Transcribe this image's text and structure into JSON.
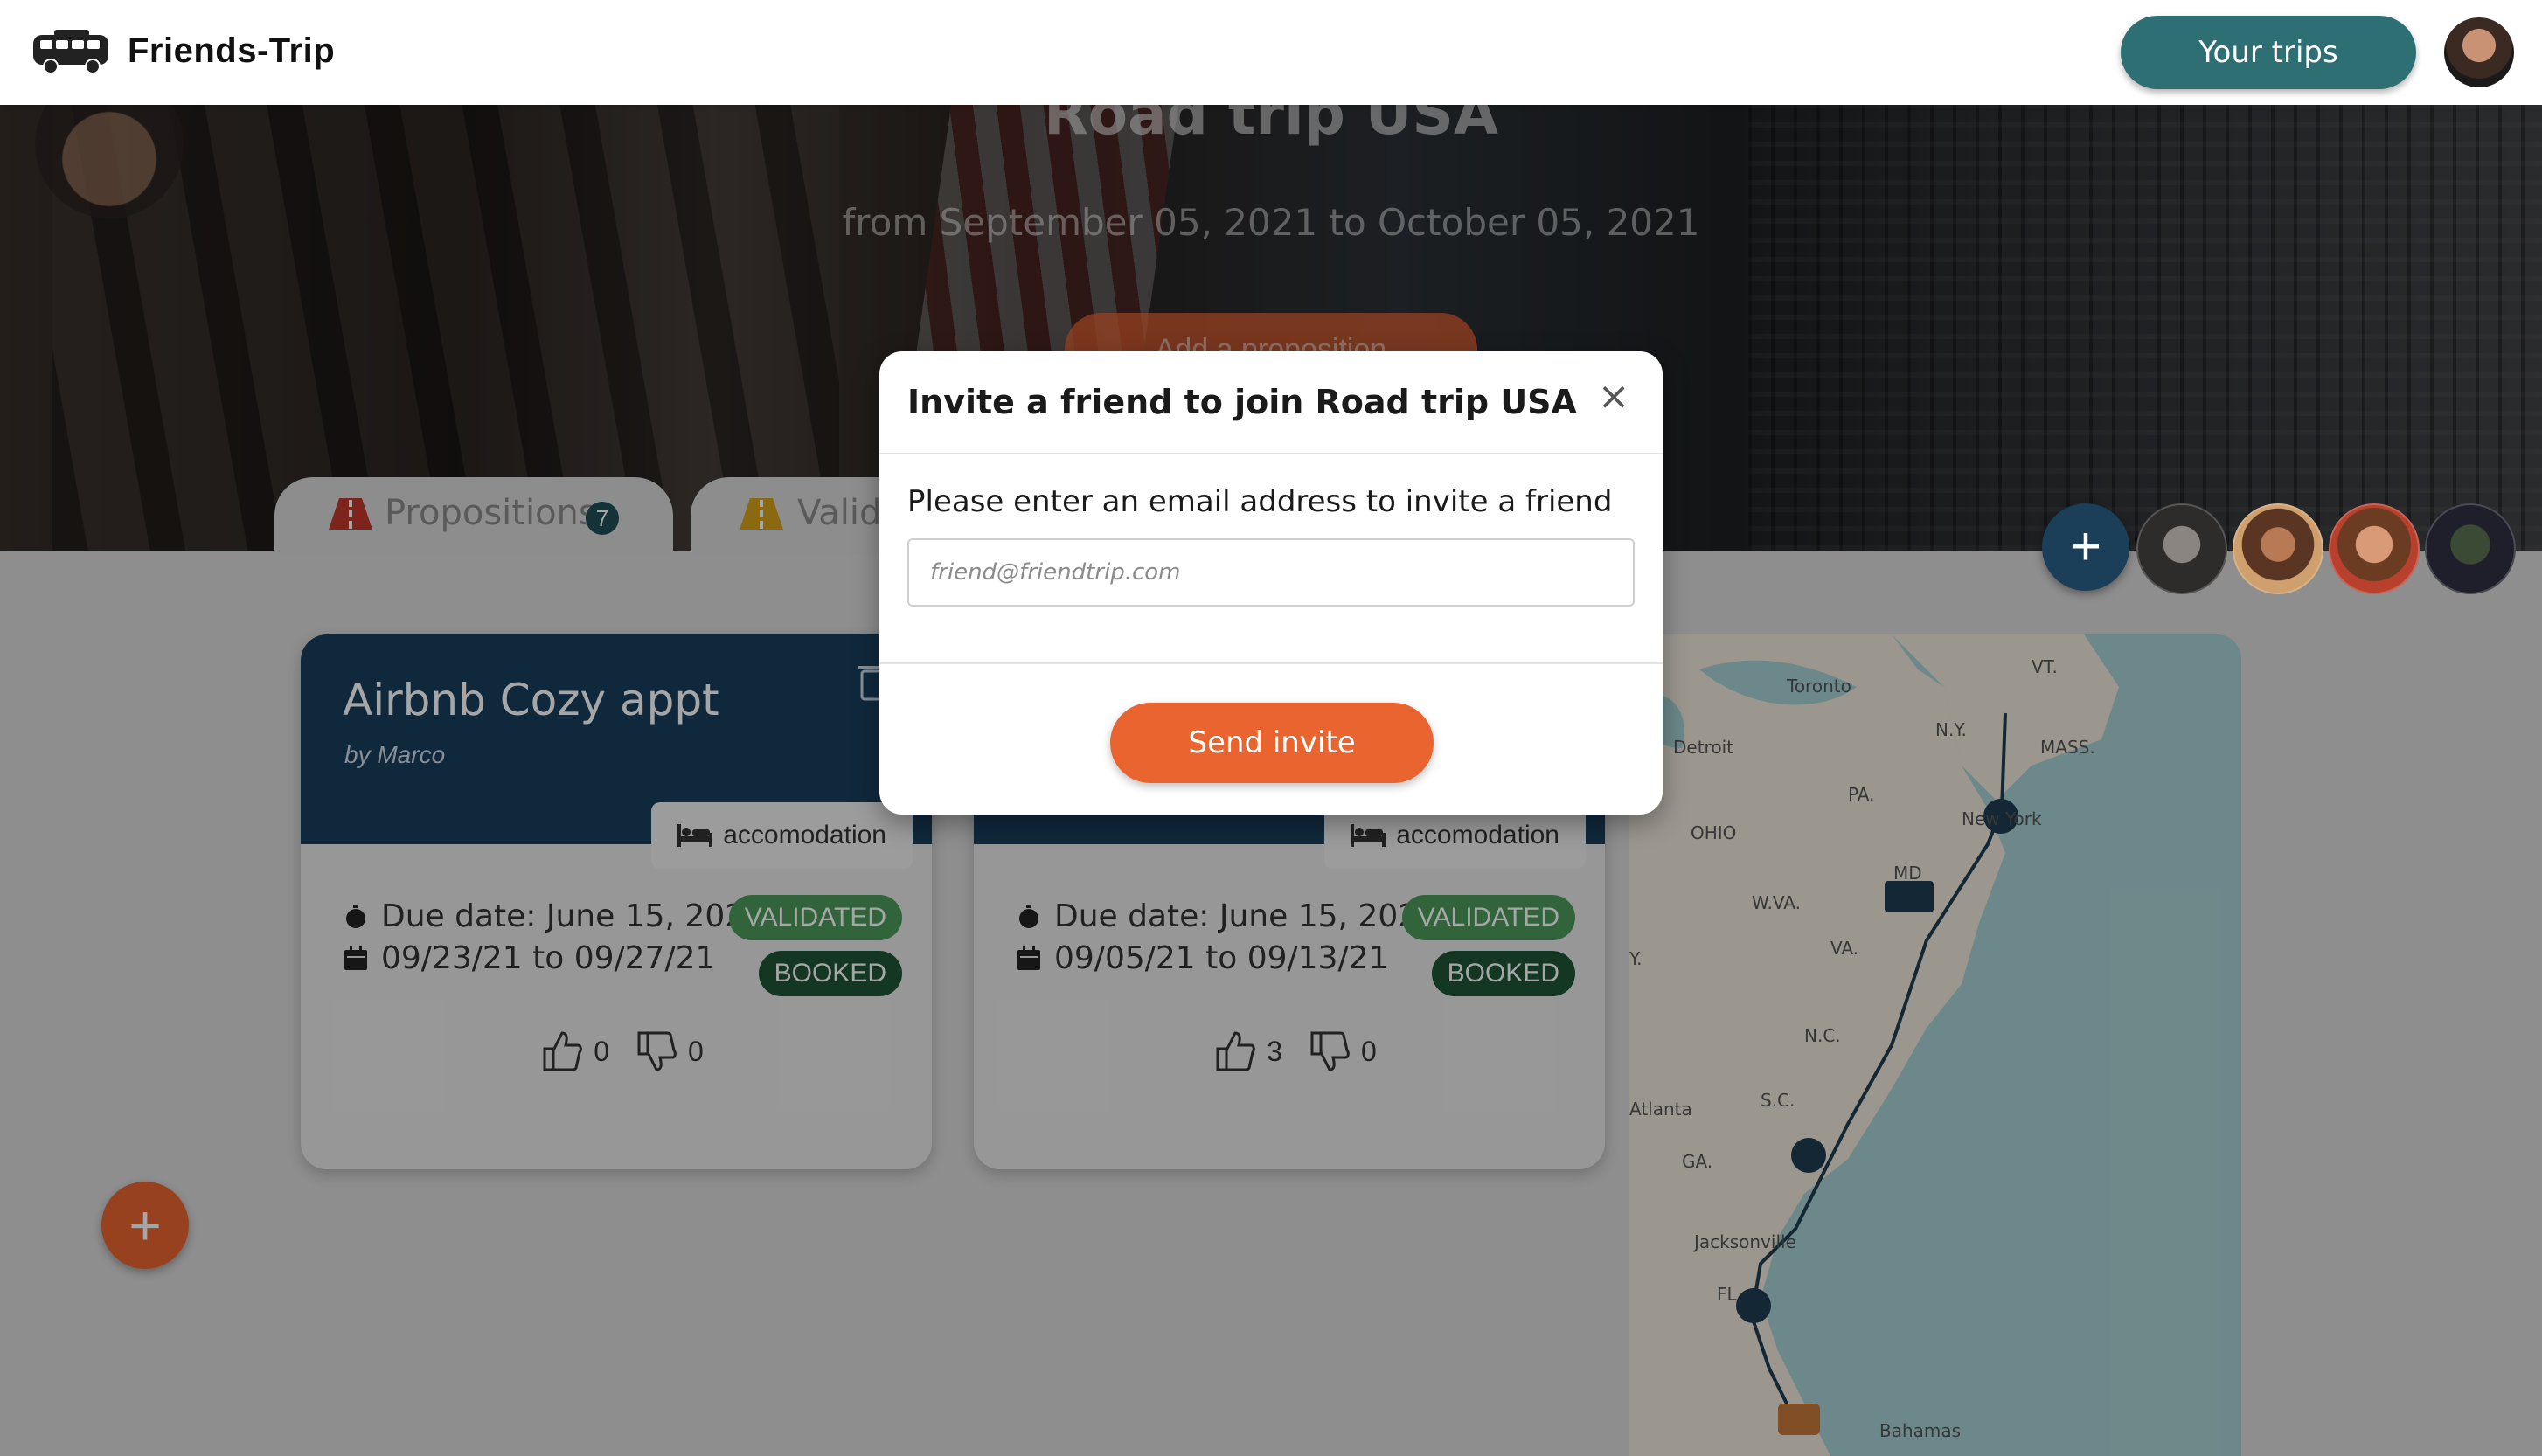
{
  "navbar": {
    "brand": "Friends-Trip",
    "your_trips": "Your trips"
  },
  "trip": {
    "title": "Road trip USA",
    "dates": "from September 05, 2021 to October 05, 2021",
    "add_proposition": "Add a proposition"
  },
  "tabs": [
    {
      "label": "Propositions",
      "count": "7"
    },
    {
      "label": "Valid"
    }
  ],
  "cards": [
    {
      "title": "Airbnb Cozy appt",
      "author": "by Marco",
      "category": "accomodation",
      "due": "Due date: June 15, 2021",
      "range": "09/23/21 to 09/27/21",
      "status_validated": "VALIDATED",
      "status_booked": "BOOKED",
      "likes": "0",
      "dislikes": "0"
    },
    {
      "title": "",
      "author": "",
      "category": "accomodation",
      "due": "Due date: June 15, 2021",
      "range": "09/05/21 to 09/13/21",
      "status_validated": "VALIDATED",
      "status_booked": "BOOKED",
      "likes": "3",
      "dislikes": "0"
    }
  ],
  "participants": {
    "add_label": "+",
    "count": 4
  },
  "fab": {
    "label": "+"
  },
  "map": {
    "labels": [
      "Toronto",
      "Detroit",
      "VT.",
      "N.Y.",
      "MASS.",
      "PA.",
      "OHIO",
      "MD",
      "W.VA.",
      "VA.",
      "Y.",
      "N.C.",
      "S.C.",
      "Atlanta",
      "GA.",
      "Jacksonville",
      "FL",
      "Bahamas",
      "New York"
    ]
  },
  "modal": {
    "title": "Invite a friend to join Road trip USA",
    "close": "×",
    "label": "Please enter an email address to invite a friend",
    "input_placeholder": "friend@friendtrip.com",
    "input_value": "",
    "send": "Send invite"
  },
  "colors": {
    "accent_orange": "#e9642f",
    "teal": "#2e6f73",
    "navy": "#1a3e5c",
    "validated_green": "#4e9a5c",
    "booked_green": "#1e5535"
  }
}
